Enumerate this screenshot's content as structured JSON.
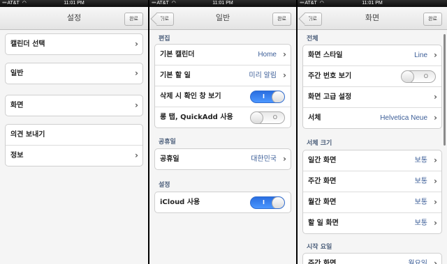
{
  "status": {
    "carrier": "AT&T",
    "time": "11:01 PM"
  },
  "panel_settings": {
    "title": "설정",
    "done_button": "완료",
    "groups": [
      [
        "캘린더 선택"
      ],
      [
        "일반"
      ],
      [
        "화면"
      ],
      [
        "의견 보내기",
        "정보"
      ]
    ]
  },
  "panel_general": {
    "title": "일반",
    "back_button": "뒤로",
    "done_button": "완료",
    "section_edit": "편집",
    "default_calendar_label": "기본 캘린더",
    "default_calendar_value": "Home",
    "default_todo_label": "기본 할 일",
    "default_todo_value": "미리 알림",
    "confirm_delete_label": "삭제 시 확인 창 보기",
    "confirm_delete_on": true,
    "long_tap_label": "롱 탭, QuickAdd 사용",
    "long_tap_on": false,
    "section_holiday": "공휴일",
    "holiday_label": "공휴일",
    "holiday_value": "대한민국",
    "section_settings": "설정",
    "icloud_label": "iCloud 사용",
    "icloud_on": true,
    "toggle_on_mark": "I",
    "toggle_off_mark": "O"
  },
  "panel_display": {
    "title": "화면",
    "back_button": "뒤로",
    "done_button": "완료",
    "section_all": "전체",
    "screen_style_label": "화면 스타일",
    "screen_style_value": "Line",
    "week_number_label": "주간 번호 보기",
    "week_number_on": false,
    "advanced_label": "화면 고급 설정",
    "font_label": "서체",
    "font_value": "Helvetica Neue",
    "section_font_size": "서체 크기",
    "font_sizes": [
      {
        "label": "일간 화면",
        "value": "보통"
      },
      {
        "label": "주간 화면",
        "value": "보통"
      },
      {
        "label": "월간 화면",
        "value": "보통"
      },
      {
        "label": "할 일 화면",
        "value": "보통"
      }
    ],
    "section_start_day": "시작 요일",
    "start_day_label": "주간 화면",
    "start_day_value": "월요일"
  }
}
